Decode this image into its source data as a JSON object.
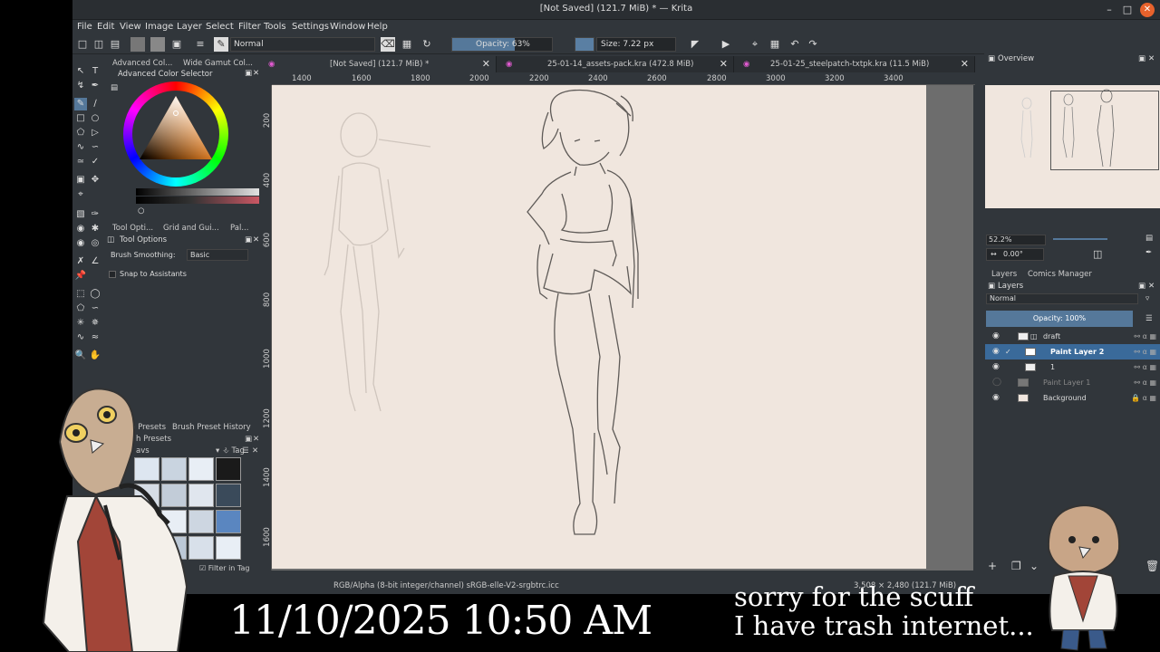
{
  "window": {
    "title": "[Not Saved] (121.7 MiB) * — Krita"
  },
  "menu": [
    "File",
    "Edit",
    "View",
    "Image",
    "Layer",
    "Select",
    "Filter",
    "Tools",
    "Settings",
    "Window",
    "Help"
  ],
  "toolbar": {
    "blend_mode": "Normal",
    "opacity": "Opacity: 63%",
    "opacity_value": 0.63,
    "size": "Size: 7.22 px"
  },
  "left_dock": {
    "tabs": [
      "Advanced Col...",
      "Wide Gamut Col..."
    ],
    "color_selector_title": "Advanced Color Selector",
    "tool_tabs": [
      "Tool Opti...",
      "Grid and Gui...",
      "Pal..."
    ],
    "tool_options_title": "Tool Options",
    "brush_smoothing_label": "Brush Smoothing:",
    "brush_smoothing_value": "Basic",
    "snap_label": "Snap to Assistants",
    "preset_tabs": [
      "h Presets",
      "Brush Preset History"
    ],
    "presets_title": "h Presets",
    "preset_filter": "avs",
    "tag_label": "Tag",
    "filter_in_tag": "Filter in Tag"
  },
  "doc_tabs": [
    {
      "label": "[Not Saved]  (121.7 MiB) *"
    },
    {
      "label": "25-01-14_assets-pack.kra (472.8 MiB)"
    },
    {
      "label": "25-01-25_steelpatch-txtpk.kra (11.5 MiB)"
    }
  ],
  "ruler": {
    "h": [
      "1400",
      "1600",
      "1800",
      "2000",
      "2200",
      "2400",
      "2600",
      "2800",
      "3000",
      "3200",
      "3400"
    ],
    "v": [
      "200",
      "400",
      "600",
      "800",
      "1000",
      "1200",
      "1400",
      "1600"
    ]
  },
  "status": {
    "color": "RGB/Alpha (8-bit integer/channel)  sRGB-elle-V2-srgbtrc.icc",
    "dims": "3,508 × 2,480 (121.7 MiB)"
  },
  "right_dock": {
    "overview_title": "Overview",
    "zoom": "52.2%",
    "rotation": "0.00°",
    "tabs": [
      "Layers",
      "Comics Manager"
    ],
    "layers_title": "Layers",
    "blend": "Normal",
    "opacity": "Opacity:  100%",
    "layers": [
      {
        "name": "draft",
        "selected": false,
        "visible": true
      },
      {
        "name": "Paint Layer 2",
        "selected": true,
        "visible": true
      },
      {
        "name": "1",
        "selected": false,
        "visible": true
      },
      {
        "name": "Paint Layer 1",
        "selected": false,
        "visible": false
      },
      {
        "name": "Background",
        "selected": false,
        "visible": true
      }
    ]
  },
  "overlay": {
    "datetime": "11/10/2025 10:50 AM",
    "note_line1": "sorry for the scuff",
    "note_line2": "I have trash internet..."
  },
  "colors": {
    "accent": "#55789a",
    "canvas": "#f0e6de",
    "panel": "#31363b",
    "close_button": "#e8622c"
  }
}
